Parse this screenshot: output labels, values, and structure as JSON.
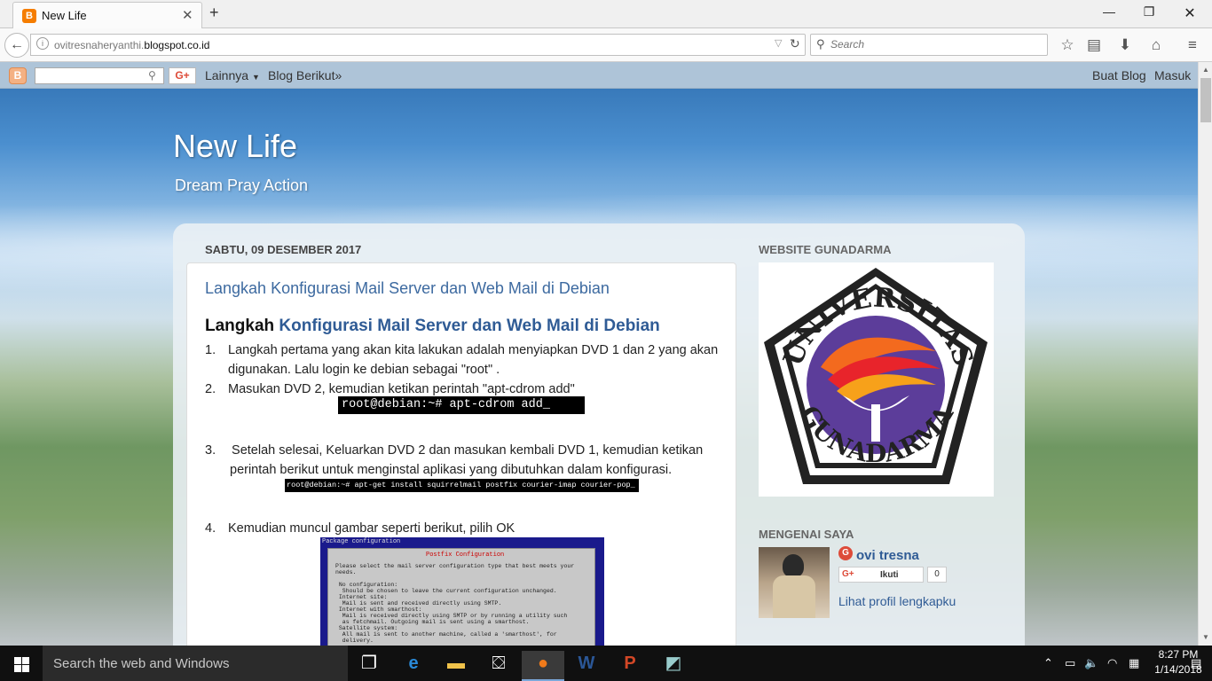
{
  "browser": {
    "tab_title": "New Life",
    "url_prefix": "ovitresnaheryanthi.",
    "url_domain": "blogspot.co.id",
    "search_placeholder": "Search"
  },
  "blogger_nav": {
    "more_label": "Lainnya",
    "next_blog_label": "Blog Berikut»",
    "create_blog_label": "Buat Blog",
    "sign_in_label": "Masuk",
    "gplus_label": "G+"
  },
  "header": {
    "title": "New Life",
    "description": "Dream Pray Action"
  },
  "post": {
    "date": "SABTU, 09 DESEMBER 2017",
    "title": "Langkah Konfigurasi Mail Server dan Web Mail di Debian",
    "heading_plain": "Langkah ",
    "heading_link": "Konfigurasi Mail Server dan Web Mail di Debian",
    "steps": [
      {
        "num": "1.",
        "text": "Langkah pertama yang akan kita lakukan adalah menyiapkan DVD 1 dan 2 yang akan",
        "cont": "digunakan. Lalu login ke debian sebagai \"root\" ."
      },
      {
        "num": "2.",
        "text": "Masukan DVD 2, kemudian ketikan perintah \"apt-cdrom add\""
      },
      {
        "num": "3.",
        "text": " Setelah selesai, Keluarkan DVD 2 dan masukan kembali DVD 1, kemudian ketikan",
        "cont": "perintah berikut untuk menginstal aplikasi yang dibutuhkan dalam konfigurasi."
      },
      {
        "num": "4.",
        "text": "Kemudian muncul gambar seperti berikut, pilih OK"
      }
    ],
    "cmd1": "root@debian:~# apt-cdrom add_",
    "cmd2": "root@debian:~# apt-get install squirrelmail postfix courier-imap courier-pop_",
    "screenshot": {
      "header": "Package configuration",
      "box_title": "Postfix Configuration",
      "body": "Please select the mail server configuration type that best meets your\nneeds.\n\n No configuration:\n  Should be chosen to leave the current configuration unchanged.\n Internet site:\n  Mail is sent and received directly using SMTP.\n Internet with smarthost:\n  Mail is received directly using SMTP or by running a utility such\n  as fetchmail. Outgoing mail is sent using a smarthost.\n Satellite system:\n  All mail is sent to another machine, called a 'smarthost', for\n  delivery."
    }
  },
  "sidebar": {
    "website_heading": "WEBSITE GUNADARMA",
    "logo_text_top": "UNIVERSITAS",
    "logo_text_bottom": "GUNADARMA",
    "about_heading": "MENGENAI SAYA",
    "author_name": "ovi tresna",
    "follow_label": "Ikuti",
    "follow_count": "0",
    "profile_link": "Lihat profil lengkapku"
  },
  "taskbar": {
    "search_text": "Search the web and Windows",
    "time": "8:27 PM",
    "date": "1/14/2018"
  }
}
